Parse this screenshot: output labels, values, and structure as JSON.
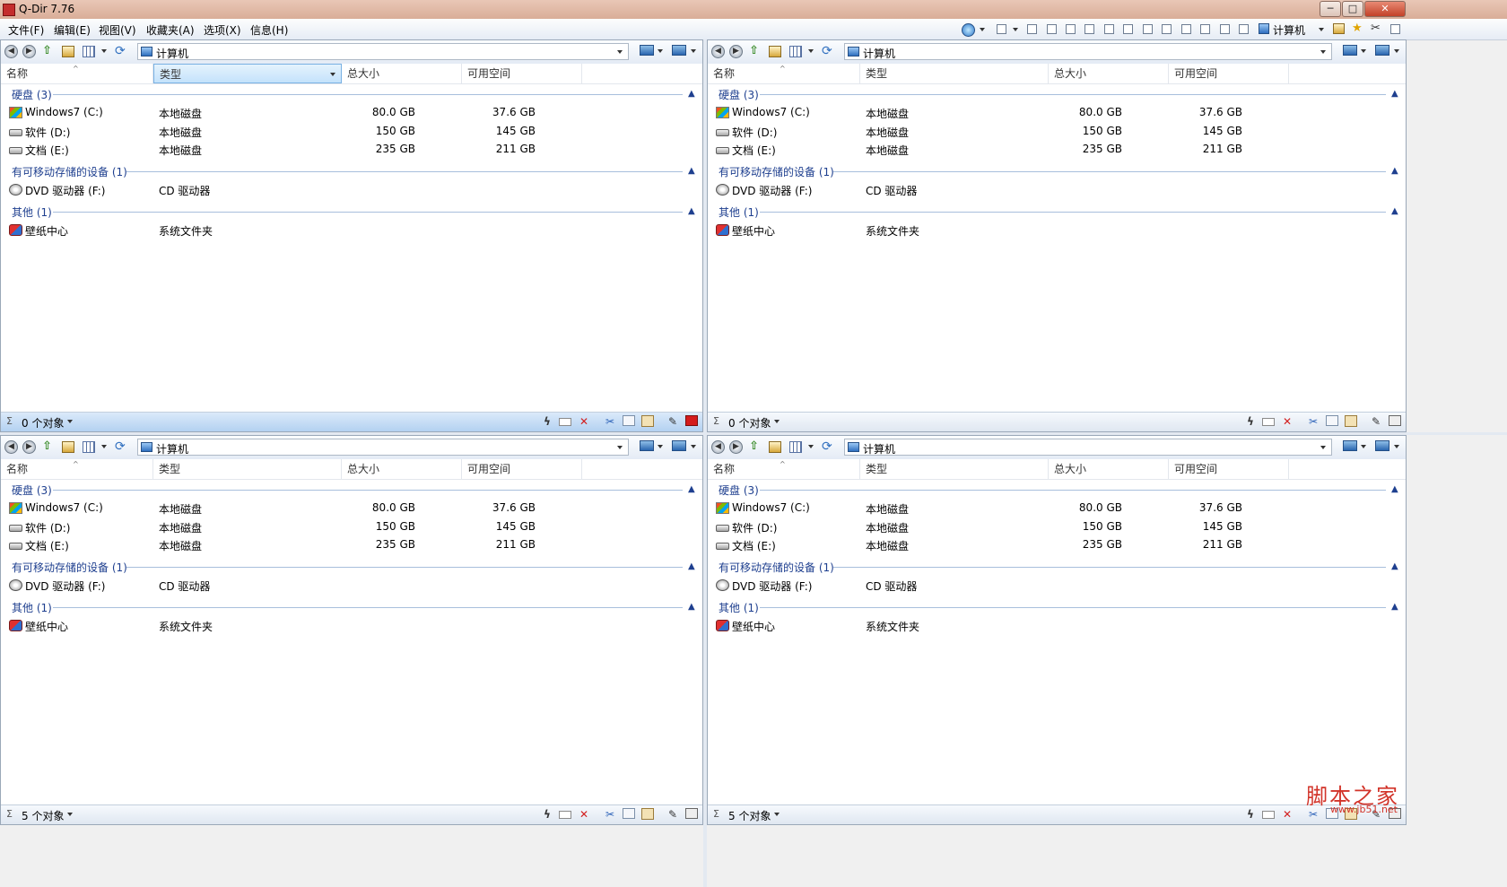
{
  "window": {
    "title": "Q-Dir 7.76",
    "ghost_tabs": [
      "",
      "",
      "",
      ""
    ],
    "controls": {
      "minimize": "─",
      "maximize": "□",
      "close": "✕"
    }
  },
  "menu": {
    "items": [
      "文件(F)",
      "编辑(E)",
      "视图(V)",
      "收藏夹(A)",
      "选项(X)",
      "信息(H)"
    ],
    "right_label": "计算机"
  },
  "columns": {
    "name": "名称",
    "type": "类型",
    "total": "总大小",
    "free": "可用空间"
  },
  "groups": {
    "hdd": "硬盘 (3)",
    "removable": "有可移动存储的设备 (1)",
    "other": "其他 (1)"
  },
  "rows": [
    {
      "name": "Windows7 (C:)",
      "type": "本地磁盘",
      "total": "80.0 GB",
      "free": "37.6 GB",
      "icon": "windows-drive-icon"
    },
    {
      "name": "软件 (D:)",
      "type": "本地磁盘",
      "total": "150 GB",
      "free": "145 GB",
      "icon": "drive-icon"
    },
    {
      "name": "文档 (E:)",
      "type": "本地磁盘",
      "total": "235 GB",
      "free": "211 GB",
      "icon": "drive-icon"
    },
    {
      "name": "DVD 驱动器 (F:)",
      "type": "CD 驱动器",
      "total": "",
      "free": "",
      "icon": "dvd-icon"
    },
    {
      "name": "壁纸中心",
      "type": "系统文件夹",
      "total": "",
      "free": "",
      "icon": "wallpaper-icon"
    }
  ],
  "panes": [
    {
      "address": "计算机",
      "status": "0 个对象",
      "active": true
    },
    {
      "address": "计算机",
      "status": "0 个对象",
      "active": false
    },
    {
      "address": "计算机",
      "status": "5 个对象",
      "active": false
    },
    {
      "address": "计算机",
      "status": "5 个对象",
      "active": false
    }
  ],
  "watermark": {
    "text": "脚本之家",
    "sub": "www.jb51.net"
  },
  "colors": {
    "accent": "#1e3f8f",
    "titlebar": "#e0b9a6",
    "status_active": "#b3d1f1"
  }
}
